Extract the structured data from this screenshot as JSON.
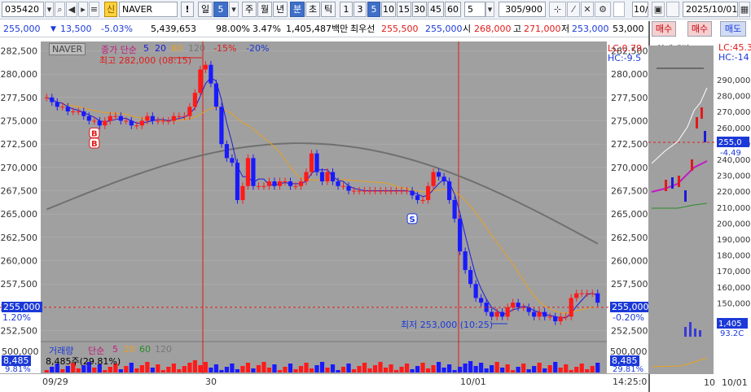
{
  "toolbar": {
    "code": "035420",
    "name_tag": "신",
    "stock_name": "NAVER",
    "alert": "!",
    "period_day": "일",
    "period_num": "5",
    "week": "주",
    "month": "월",
    "year": "년",
    "minute": "분",
    "second": "초",
    "tick": "틱",
    "intervals": [
      "1",
      "3",
      "5",
      "10",
      "15",
      "30",
      "45",
      "60"
    ],
    "count": "5",
    "range": "305/900",
    "date": "2025/10/01",
    "right_num": "10/"
  },
  "quote": {
    "price": "255,000",
    "change": "13,500",
    "change_pct": "-5.03%",
    "volume": "5,439,653",
    "ratio": "98.00%",
    "turnover_pct": "3.47%",
    "amount": "1,405,487백만",
    "best_label": "최우선",
    "ask": "255,500",
    "bid": "255,000",
    "open_label": "시",
    "open": "268,000",
    "high_label": "고",
    "high": "271,000",
    "low_label": "저",
    "low": "253,000",
    "right_price": "53,000",
    "buy": "매수",
    "sell": "매도"
  },
  "chart": {
    "title": "NAVER",
    "legend_price": "종가 단순",
    "ma": [
      "5",
      "20",
      "60",
      "120"
    ],
    "ma_colors": [
      "#1b1bd8",
      "#e8a020",
      "#4a4a4a",
      "#888888"
    ],
    "pct_minus15": "-15%",
    "pct_minus20": "-20%",
    "high_note": "최고 282,000 (08:15)",
    "low_note": "최저 253,000 (10:25)",
    "lc": "LC:0.79",
    "hc": "HC:-9.5",
    "left_price_tag": "255,000",
    "left_pct_tag": "1.20%",
    "right_price_tag": "255,000",
    "right_pct_tag": "-0.20%",
    "y_ticks": [
      "282,500",
      "280,000",
      "277,500",
      "275,000",
      "272,500",
      "270,000",
      "267,500",
      "265,000",
      "262,500",
      "260,000",
      "257,500",
      "255,000",
      "252,500"
    ],
    "vol_label": "거래량",
    "vol_legend": "단순",
    "vol_ma": [
      "5",
      "20",
      "60",
      "120"
    ],
    "vol_value": "8,485주(29.81%)",
    "vol_tag_left": "8,485",
    "vol_tag_left_pct": "9.81%",
    "vol_tag_right": "8,485",
    "vol_tag_right_pct": "29.81%",
    "vol_ticks": [
      "500,000",
      "500,000"
    ],
    "x_labels": [
      "09/29",
      "30",
      "10/01"
    ],
    "time_label": "14:25:0"
  },
  "chart_data": {
    "type": "candlestick",
    "title": "NAVER",
    "ylim": [
      251500,
      283500
    ],
    "close": [
      277500,
      277000,
      276500,
      276500,
      276000,
      276000,
      276000,
      275500,
      275000,
      275000,
      274500,
      275000,
      275500,
      275500,
      275000,
      275000,
      274500,
      274500,
      275000,
      275500,
      275000,
      275000,
      275000,
      275000,
      275500,
      275500,
      275500,
      276500,
      278000,
      280500,
      281000,
      279000,
      276500,
      272500,
      271000,
      270500,
      266500,
      268000,
      271000,
      268000,
      268000,
      268000,
      268500,
      268000,
      268500,
      268500,
      268000,
      268000,
      268500,
      269500,
      271500,
      269500,
      268500,
      269500,
      268500,
      268000,
      268000,
      267500,
      267500,
      267500,
      267500,
      267500,
      267500,
      267500,
      267500,
      267500,
      267500,
      267500,
      267500,
      267000,
      266500,
      266500,
      268000,
      269500,
      269000,
      268500,
      266500,
      264500,
      261000,
      259000,
      257500,
      256000,
      255500,
      254500,
      254000,
      254500,
      254000,
      255000,
      255500,
      255000,
      255000,
      254500,
      254000,
      254500,
      254000,
      254000,
      253500,
      254000,
      254000,
      256000,
      256500,
      256500,
      256500,
      256500,
      255500
    ],
    "x_labels": [
      "09/29",
      "30",
      "10/01"
    ],
    "min_label": "최저 253,000 (10:25)",
    "max_label": "최고 282,000 (08:15)"
  },
  "side_panel": {
    "title": "약세패턴",
    "lc": "LC:45.3",
    "hc": "HC:-14",
    "y_ticks": [
      "290,000",
      "280,000",
      "270,000",
      "260,000",
      "250,000",
      "240,000",
      "230,000",
      "220,000",
      "210,000",
      "200,000",
      "190,000",
      "180,000",
      "170,000",
      "160,000",
      "150,000"
    ],
    "price_tag": "255,0",
    "pct_tag": "-4.49",
    "vol_tag": "1,405",
    "vol_pct": "93.2C",
    "x_label_left": "10",
    "x_label_right": "10/01"
  }
}
